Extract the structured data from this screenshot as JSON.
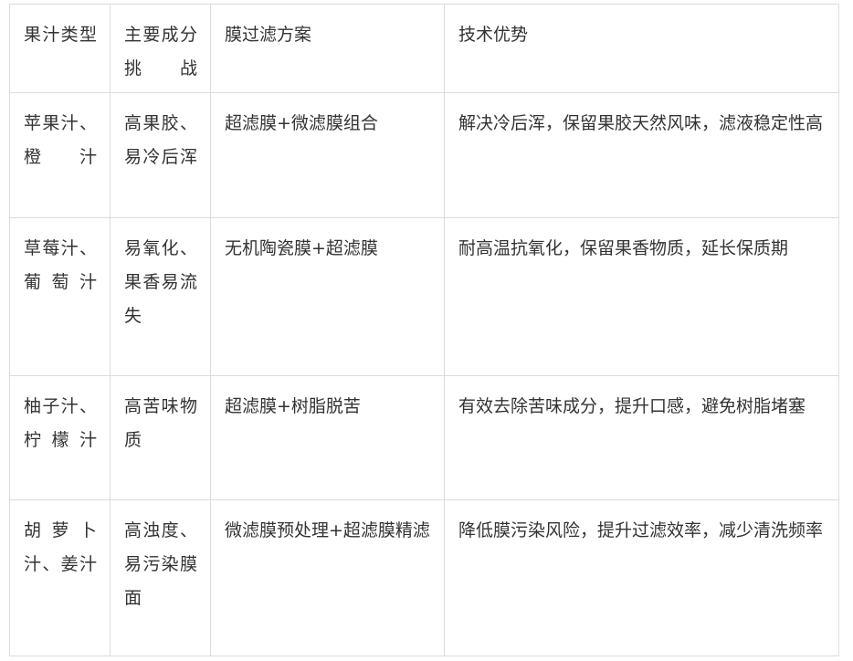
{
  "table": {
    "header": [
      "果汁类型",
      "主要成分挑战",
      "膜过滤方案",
      "技术优势"
    ],
    "rows": [
      [
        "苹果汁、橙汁",
        "高果胶、易冷后浑",
        "超滤膜+微滤膜组合",
        "解决冷后浑，保留果胶天然风味，滤液稳定性高"
      ],
      [
        "草莓汁、葡萄汁",
        "易氧化、果香易流失",
        "无机陶瓷膜+超滤膜",
        "耐高温抗氧化，保留果香物质，延长保质期"
      ],
      [
        "柚子汁、柠檬汁",
        "高苦味物质",
        "超滤膜+树脂脱苦",
        "有效去除苦味成分，提升口感，避免树脂堵塞"
      ],
      [
        "胡萝卜汁、姜汁",
        "高浊度、易污染膜面",
        "微滤膜预处理+超滤膜精滤",
        "降低膜污染风险，提升过滤效率，减少清洗频率"
      ]
    ]
  }
}
